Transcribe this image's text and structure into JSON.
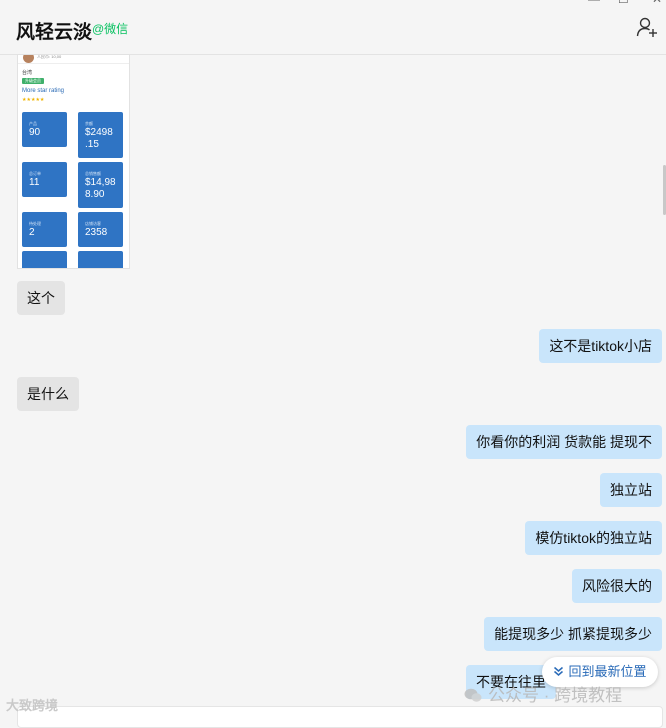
{
  "header": {
    "chat_name": "风轻云淡",
    "source_tag": "@微信",
    "add_user_icon": "add-user-icon"
  },
  "thumbnail": {
    "header_text": "人民币: 10,00",
    "shop_label": "台湾",
    "badge": "升级会员",
    "rating_label": "More star rating",
    "stars": "★★★★★",
    "tiles": [
      {
        "label": "产品",
        "value": "90"
      },
      {
        "label": "余额",
        "value": "$2498\n.15"
      },
      {
        "label": "总订单",
        "value": "11"
      },
      {
        "label": "总销售额",
        "value": "$14,98\n8.90"
      },
      {
        "label": "待处理",
        "value": "2"
      },
      {
        "label": "店铺访客",
        "value": "2358"
      },
      {
        "label": "",
        "value": ""
      },
      {
        "label": "",
        "value": ""
      }
    ]
  },
  "messages": [
    {
      "side": "in",
      "text": "这个"
    },
    {
      "side": "out",
      "text": "这不是tiktok小店"
    },
    {
      "side": "in",
      "text": "是什么"
    },
    {
      "side": "out",
      "text": "你看你的利润  货款能 提现不"
    },
    {
      "side": "out",
      "text": "独立站"
    },
    {
      "side": "out",
      "text": "模仿tiktok的独立站"
    },
    {
      "side": "out",
      "text": "风险很大的"
    },
    {
      "side": "out",
      "text": "能提现多少  抓紧提现多少"
    },
    {
      "side": "out",
      "text": "不要在往里"
    }
  ],
  "back_to_latest": "回到最新位置",
  "watermarks": {
    "bottom_left": "大致跨境",
    "right": "公众号 · 跨境教程"
  }
}
